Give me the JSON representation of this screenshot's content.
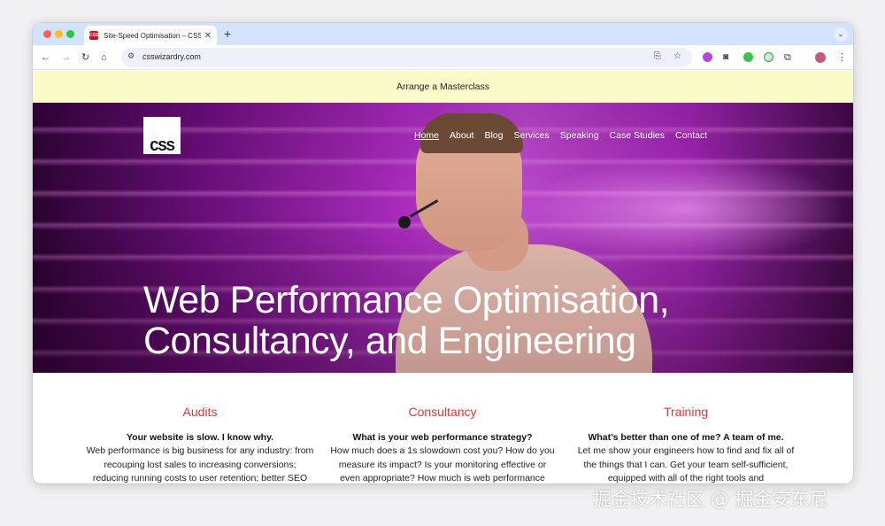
{
  "browser": {
    "tab_title": "Site-Speed Optimisation – CSS",
    "favicon_text": "CSS",
    "url": "csswizardry.com",
    "icons": [
      "back-icon",
      "forward-icon",
      "reload-icon",
      "home-icon",
      "site-info-icon",
      "install-icon",
      "bookmark-star-icon",
      "extension-purple-icon",
      "camera-icon",
      "extension-green-icon",
      "extension-k-icon",
      "extensions-puzzle-icon",
      "profile-avatar",
      "menu-kebab-icon"
    ]
  },
  "banner": {
    "label": "Arrange a Masterclass"
  },
  "header": {
    "logo_text": "CSS",
    "nav": [
      {
        "label": "Home",
        "active": true
      },
      {
        "label": "About"
      },
      {
        "label": "Blog"
      },
      {
        "label": "Services"
      },
      {
        "label": "Speaking"
      },
      {
        "label": "Case Studies"
      },
      {
        "label": "Contact"
      }
    ]
  },
  "hero": {
    "title_line1": "Web Performance Optimisation,",
    "title_line2": "Consultancy, and Engineering"
  },
  "services": [
    {
      "title": "Audits",
      "lead": "Your website is slow. I know why.",
      "body": "Web performance is big business for any industry: from recouping lost sales to increasing conversions; reducing running costs to user retention; better SEO"
    },
    {
      "title": "Consultancy",
      "lead": "What is your web performance strategy?",
      "body": "How much does a 1s slowdown cost you? How do you measure its impact? Is your monitoring effective or even appropriate? How much is web performance"
    },
    {
      "title": "Training",
      "lead": "What’s better than one of me? A team of me.",
      "body": "Let me show your engineers how to find and fix all of the things that I can. Get your team self-sufficient, equipped with all of the right tools and"
    }
  ],
  "watermark": "掘金技术社区 @ 掘金安东尼",
  "colors": {
    "accent_red": "#d93a3a",
    "banner_bg": "#fbfbc9",
    "tab_strip": "#d3e3fd"
  }
}
